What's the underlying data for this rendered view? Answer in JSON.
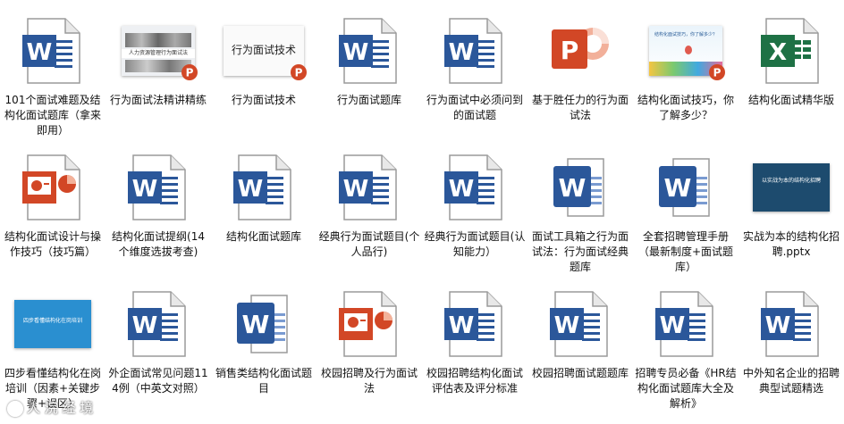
{
  "watermark": {
    "text": "人 浣 经 境"
  },
  "colors": {
    "word": "#2b579a",
    "ppt": "#d24726",
    "excel": "#1e7145"
  },
  "files": [
    {
      "label": "101个面试难题及结构化面试题库（拿来即用）",
      "icon": "word-doc-icon"
    },
    {
      "label": "行为面试法精讲精练",
      "icon": "ppt-thumb-people",
      "thumb_text": "人力资源管理行为面试法"
    },
    {
      "label": "行为面试技术",
      "icon": "ppt-thumb-title",
      "thumb_text": "行为面试技术"
    },
    {
      "label": "行为面试题库",
      "icon": "word-doc-icon"
    },
    {
      "label": "行为面试中必须问到的面试题",
      "icon": "word-doc-icon"
    },
    {
      "label": "基于胜任力的行为面试法",
      "icon": "ppt-app-icon"
    },
    {
      "label": "结构化面试技巧，你了解多少？",
      "icon": "ppt-thumb-balloon",
      "thumb_text": "结构化面试技巧，你了解多少？"
    },
    {
      "label": "结构化面试精华版",
      "icon": "excel-doc-icon"
    },
    {
      "label": "结构化面试设计与操作技巧（技巧篇）",
      "icon": "ppt-doc-icon"
    },
    {
      "label": "结构化面试提纲(14个维度选拔考查)",
      "icon": "word-doc-icon"
    },
    {
      "label": "结构化面试题库",
      "icon": "word-doc-icon"
    },
    {
      "label": "经典行为面试题目(个人品行)",
      "icon": "word-doc-icon"
    },
    {
      "label": "经典行为面试题目(认知能力）",
      "icon": "word-doc-icon"
    },
    {
      "label": "面试工具箱之行为面试法：行为面试经典题库",
      "icon": "word-app-icon"
    },
    {
      "label": "全套招聘管理手册（最新制度+面试题库）",
      "icon": "word-app-icon"
    },
    {
      "label": "实战为本的结构化招聘.pptx",
      "icon": "ppt-thumb-dark",
      "thumb_text": "以实战为本的结构化招聘"
    },
    {
      "label": "四步看懂结构化在岗培训（因素+关键步骤+误区）",
      "icon": "ppt-thumb-blue",
      "thumb_text": "四步看懂结构化在岗培训"
    },
    {
      "label": "外企面试常见问题114例（中英文对照）",
      "icon": "word-doc-icon"
    },
    {
      "label": "销售类结构化面试题目",
      "icon": "word-app-icon"
    },
    {
      "label": "校园招聘及行为面试法",
      "icon": "ppt-doc-icon"
    },
    {
      "label": "校园招聘结构化面试评估表及评分标准",
      "icon": "word-doc-icon"
    },
    {
      "label": "校园招聘面试题题库",
      "icon": "word-doc-icon"
    },
    {
      "label": "招聘专员必备《HR结构化面试题库大全及解析》",
      "icon": "word-doc-icon"
    },
    {
      "label": "中外知名企业的招聘典型试题精选",
      "icon": "word-doc-icon"
    }
  ]
}
